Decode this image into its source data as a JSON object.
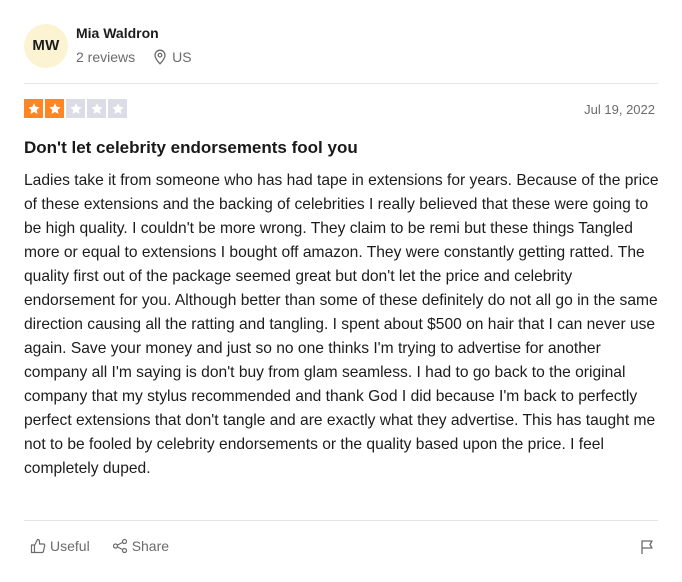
{
  "reviewer": {
    "initials": "MW",
    "name": "Mia Waldron",
    "review_count": "2 reviews",
    "country": "US"
  },
  "review": {
    "rating": 2,
    "max_rating": 5,
    "date": "Jul 19, 2022",
    "title": "Don't let celebrity endorsements fool you",
    "body": "Ladies take it from someone who has had tape in extensions for years. Because of the price of these extensions and the backing of celebrities I really believed that these were going to be high quality. I couldn't be more wrong. They claim to be remi but these things Tangled more or equal to extensions I bought off amazon. They were constantly getting ratted. The quality first out of the package seemed great but don't let the price and celebrity endorsement for you. Although better than some of these definitely do not all go in the same direction causing all the ratting and tangling. I spent about $500 on hair that I can never use again. Save your money and just so no one thinks I'm trying to advertise for another company all I'm saying is don't buy from glam seamless. I had to go back to the original company that my stylus recommended and thank God I did because I'm back to perfectly perfect extensions that don't tangle and are exactly what they advertise. This has taught me not to be fooled by celebrity endorsements or the quality based upon the price. I feel completely duped."
  },
  "actions": {
    "useful_label": "Useful",
    "share_label": "Share"
  },
  "icons": {
    "location": "location-pin-icon",
    "useful": "thumbs-up-icon",
    "share": "share-icon",
    "flag": "flag-icon",
    "star": "star-icon"
  },
  "colors": {
    "star_filled": "#ff8622",
    "star_empty": "#dcdce6",
    "avatar_bg": "#fcf3d3",
    "muted_text": "#6b6b6b"
  }
}
